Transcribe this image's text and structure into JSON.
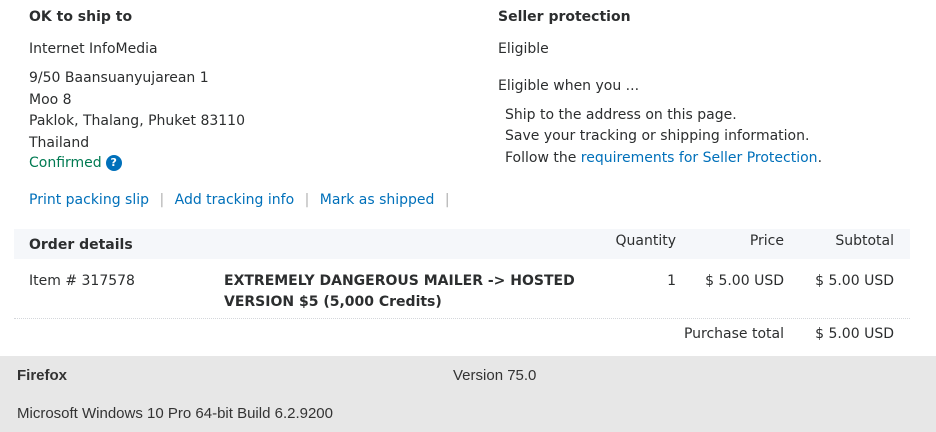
{
  "ship": {
    "heading": "OK to ship to",
    "name": "Internet InfoMedia",
    "address": [
      "9/50 Baansuanyujarean 1",
      "Moo 8",
      "Paklok, Thalang, Phuket 83110",
      "Thailand"
    ],
    "status": "Confirmed",
    "help_icon": "?"
  },
  "seller": {
    "heading": "Seller protection",
    "status": "Eligible",
    "intro": "Eligible when you ...",
    "line1": "Ship to the address on this page.",
    "line2": "Save your tracking or shipping information.",
    "line3_prefix": "Follow the ",
    "line3_link": "requirements for Seller Protection",
    "line3_suffix": "."
  },
  "actions": {
    "print": "Print packing slip",
    "tracking": "Add tracking info",
    "shipped": "Mark as shipped",
    "separator": "|"
  },
  "order": {
    "title": "Order details",
    "col_quantity": "Quantity",
    "col_price": "Price",
    "col_subtotal": "Subtotal",
    "item_id": "Item # 317578",
    "item_name_line1": "EXTREMELY DANGEROUS MAILER -> HOSTED",
    "item_name_line2": "VERSION $5 (5,000 Credits)",
    "quantity": "1",
    "price": "$ 5.00 USD",
    "subtotal": "$ 5.00 USD",
    "total_label": "Purchase total",
    "total_value": "$ 5.00 USD"
  },
  "footer": {
    "browser": "Firefox",
    "version": "Version 75.0",
    "os": "Microsoft Windows 10 Pro 64-bit Build 6.2.9200"
  }
}
